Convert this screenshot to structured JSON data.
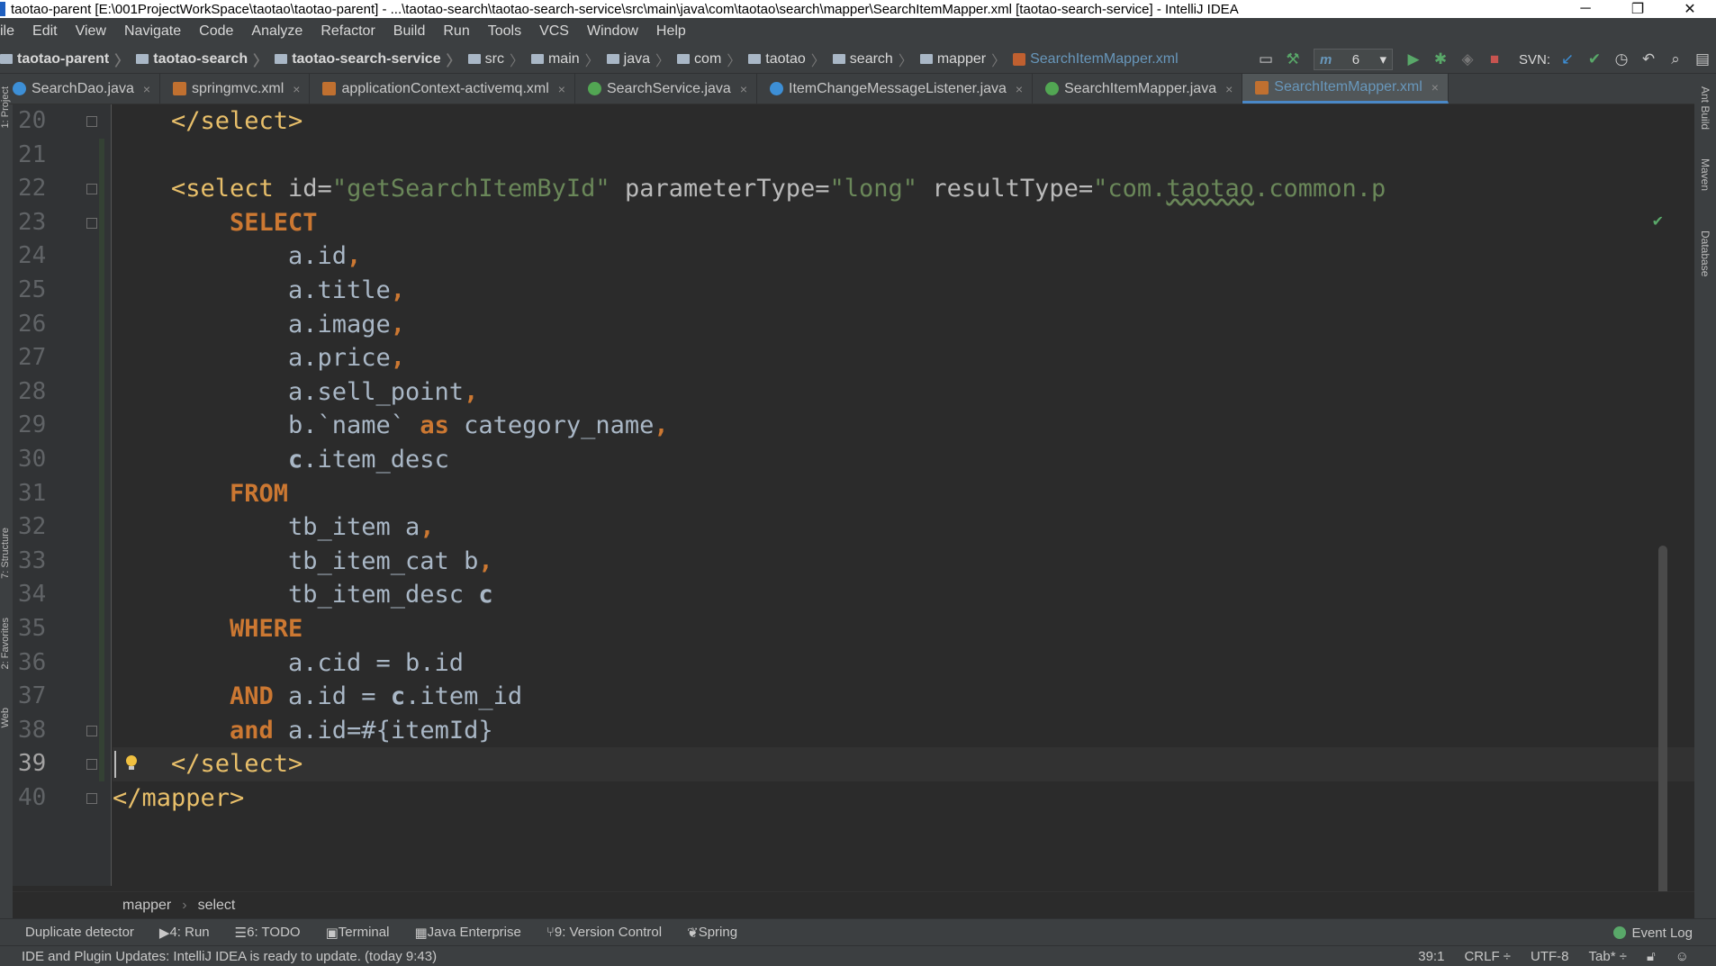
{
  "window": {
    "title": "taotao-parent [E:\\001ProjectWorkSpace\\taotao\\taotao-parent] - ...\\taotao-search\\taotao-search-service\\src\\main\\java\\com\\taotao\\search\\mapper\\SearchItemMapper.xml [taotao-search-service] - IntelliJ IDEA",
    "minimize": "─",
    "restore": "❐",
    "close": "✕"
  },
  "menu": [
    "ile",
    "Edit",
    "View",
    "Navigate",
    "Code",
    "Analyze",
    "Refactor",
    "Build",
    "Run",
    "Tools",
    "VCS",
    "Window",
    "Help"
  ],
  "breadcrumbs": [
    {
      "label": "taotao-parent",
      "bold": true
    },
    {
      "label": "taotao-search",
      "bold": true
    },
    {
      "label": "taotao-search-service",
      "bold": true
    },
    {
      "label": "src",
      "bold": false
    },
    {
      "label": "main",
      "bold": false
    },
    {
      "label": "java",
      "bold": false
    },
    {
      "label": "com",
      "bold": false
    },
    {
      "label": "taotao",
      "bold": false
    },
    {
      "label": "search",
      "bold": false
    },
    {
      "label": "mapper",
      "bold": false
    }
  ],
  "breadcrumb_file": "SearchItemMapper.xml",
  "run_config": "6",
  "svn_label": "SVN:",
  "tabs": [
    {
      "label": "SearchDao.java",
      "icon": "c",
      "active": false
    },
    {
      "label": "springmvc.xml",
      "icon": "x",
      "active": false
    },
    {
      "label": "applicationContext-activemq.xml",
      "icon": "x",
      "active": false
    },
    {
      "label": "SearchService.java",
      "icon": "i",
      "active": false
    },
    {
      "label": "ItemChangeMessageListener.java",
      "icon": "c",
      "active": false
    },
    {
      "label": "SearchItemMapper.java",
      "icon": "i",
      "active": false
    },
    {
      "label": "SearchItemMapper.xml",
      "icon": "x",
      "active": true
    }
  ],
  "left_tool_windows": [
    "1: Project",
    "7: Structure",
    "2: Favorites",
    "Web"
  ],
  "right_tool_windows": [
    "Ant Build",
    "Maven",
    "Database"
  ],
  "editor": {
    "current_line": 39,
    "lines": [
      {
        "n": "20",
        "indent": 2,
        "tokens": [
          [
            "tag",
            "</select>"
          ]
        ]
      },
      {
        "n": "21",
        "indent": 0,
        "tokens": []
      },
      {
        "n": "22",
        "indent": 2,
        "tokens": [
          [
            "tag",
            "<select "
          ],
          [
            "attr",
            "id="
          ],
          [
            "val",
            "\"getSearchItemById\""
          ],
          [
            "attr",
            " parameterType="
          ],
          [
            "val",
            "\"long\""
          ],
          [
            "attr",
            " resultType="
          ],
          [
            "val",
            "\"com."
          ],
          [
            "squig",
            "taotao"
          ],
          [
            "val",
            ".common.p"
          ]
        ]
      },
      {
        "n": "23",
        "indent": 4,
        "tokens": [
          [
            "kw",
            "SELECT"
          ]
        ]
      },
      {
        "n": "24",
        "indent": 6,
        "tokens": [
          [
            "col",
            "a.id"
          ],
          [
            "kw",
            ","
          ]
        ]
      },
      {
        "n": "25",
        "indent": 6,
        "tokens": [
          [
            "col",
            "a.title"
          ],
          [
            "kw",
            ","
          ]
        ]
      },
      {
        "n": "26",
        "indent": 6,
        "tokens": [
          [
            "col",
            "a.image"
          ],
          [
            "kw",
            ","
          ]
        ]
      },
      {
        "n": "27",
        "indent": 6,
        "tokens": [
          [
            "col",
            "a.price"
          ],
          [
            "kw",
            ","
          ]
        ]
      },
      {
        "n": "28",
        "indent": 6,
        "tokens": [
          [
            "col",
            "a.sell_point"
          ],
          [
            "kw",
            ","
          ]
        ]
      },
      {
        "n": "29",
        "indent": 6,
        "tokens": [
          [
            "col",
            "b.`name` "
          ],
          [
            "kw",
            "as"
          ],
          [
            "col",
            " category_name"
          ],
          [
            "kw",
            ","
          ]
        ]
      },
      {
        "n": "30",
        "indent": 6,
        "tokens": [
          [
            "alias",
            "c"
          ],
          [
            "col",
            ".item_desc"
          ]
        ]
      },
      {
        "n": "31",
        "indent": 4,
        "tokens": [
          [
            "kw",
            "FROM"
          ]
        ]
      },
      {
        "n": "32",
        "indent": 6,
        "tokens": [
          [
            "col",
            "tb_item a"
          ],
          [
            "kw",
            ","
          ]
        ]
      },
      {
        "n": "33",
        "indent": 6,
        "tokens": [
          [
            "col",
            "tb_item_cat b"
          ],
          [
            "kw",
            ","
          ]
        ]
      },
      {
        "n": "34",
        "indent": 6,
        "tokens": [
          [
            "col",
            "tb_item_desc "
          ],
          [
            "alias",
            "c"
          ]
        ]
      },
      {
        "n": "35",
        "indent": 4,
        "tokens": [
          [
            "kw",
            "WHERE"
          ]
        ]
      },
      {
        "n": "36",
        "indent": 6,
        "tokens": [
          [
            "col",
            "a.cid = b.id"
          ]
        ]
      },
      {
        "n": "37",
        "indent": 4,
        "tokens": [
          [
            "kw",
            "AND "
          ],
          [
            "col",
            "a.id = "
          ],
          [
            "alias",
            "c"
          ],
          [
            "col",
            ".item_id"
          ]
        ]
      },
      {
        "n": "38",
        "indent": 4,
        "tokens": [
          [
            "kw",
            "and "
          ],
          [
            "col",
            "a.id=#{itemId}"
          ]
        ]
      },
      {
        "n": "39",
        "indent": 2,
        "tokens": [
          [
            "tag",
            "</select>"
          ]
        ]
      },
      {
        "n": "40",
        "indent": 0,
        "tokens": [
          [
            "tag",
            "</mapper>"
          ]
        ]
      }
    ]
  },
  "editor_breadcrumbs": [
    "mapper",
    "select"
  ],
  "bottom_tools": [
    {
      "label": "Duplicate detector",
      "icon": ""
    },
    {
      "label": "4: Run",
      "icon": "▶"
    },
    {
      "label": "6: TODO",
      "icon": "☰"
    },
    {
      "label": "Terminal",
      "icon": "▣"
    },
    {
      "label": "Java Enterprise",
      "icon": "▦"
    },
    {
      "label": "9: Version Control",
      "icon": "⑂"
    },
    {
      "label": "Spring",
      "icon": "❦"
    }
  ],
  "event_log": "Event Log",
  "status": {
    "message": "IDE and Plugin Updates: IntelliJ IDEA is ready to update. (today 9:43)",
    "position": "39:1",
    "line_sep": "CRLF ÷",
    "encoding": "UTF-8",
    "indent": "Tab* ÷"
  },
  "colors": {
    "tag": "#e8bf6a",
    "keyword": "#cc7832",
    "string": "#6a8759",
    "text": "#a9b7c6",
    "active_tab_underline": "#4a88c7"
  }
}
